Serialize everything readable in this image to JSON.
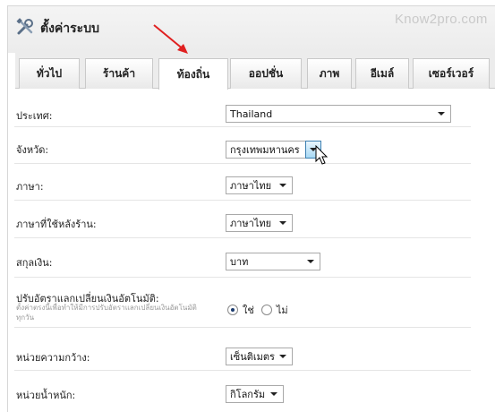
{
  "header": {
    "title": "ตั้งค่าระบบ",
    "icon": "tools-icon",
    "watermark": "Know2pro.com"
  },
  "tabs": [
    {
      "label": "ทั่วไป",
      "active": false
    },
    {
      "label": "ร้านค้า",
      "active": false
    },
    {
      "label": "ท้องถิ่น",
      "active": true
    },
    {
      "label": "ออปชั่น",
      "active": false
    },
    {
      "label": "ภาพ",
      "active": false
    },
    {
      "label": "อีเมล์",
      "active": false
    },
    {
      "label": "เซอร์เวอร์",
      "active": false
    }
  ],
  "form": {
    "country": {
      "label": "ประเทศ:",
      "value": "Thailand"
    },
    "province": {
      "label": "จังหวัด:",
      "value": "กรุงเทพมหานคร"
    },
    "language": {
      "label": "ภาษา:",
      "value": "ภาษาไทย"
    },
    "admin_language": {
      "label": "ภาษาที่ใช้หลังร้าน:",
      "value": "ภาษาไทย"
    },
    "currency": {
      "label": "สกุลเงิน:",
      "value": "บาท"
    },
    "auto_currency": {
      "label": "ปรับอัตราแลกเปลี่ยนเงินอัตโนมัติ:",
      "hint": "ตั้งค่าตรงนี้เพื่อทำให้มีการปรับอัตราแลกเปลี่ยนเงินอัตโนมัติทุกวัน",
      "options": [
        "ใช่",
        "ไม่"
      ],
      "selected": "ใช่"
    },
    "length_unit": {
      "label": "หน่วยความกว้าง:",
      "value": "เซ็นติเมตร"
    },
    "weight_unit": {
      "label": "หน่วยน้ำหนัก:",
      "value": "กิโลกรัม"
    }
  },
  "colors": {
    "annotation_arrow": "#e02020",
    "accent": "#3c7fb1"
  }
}
